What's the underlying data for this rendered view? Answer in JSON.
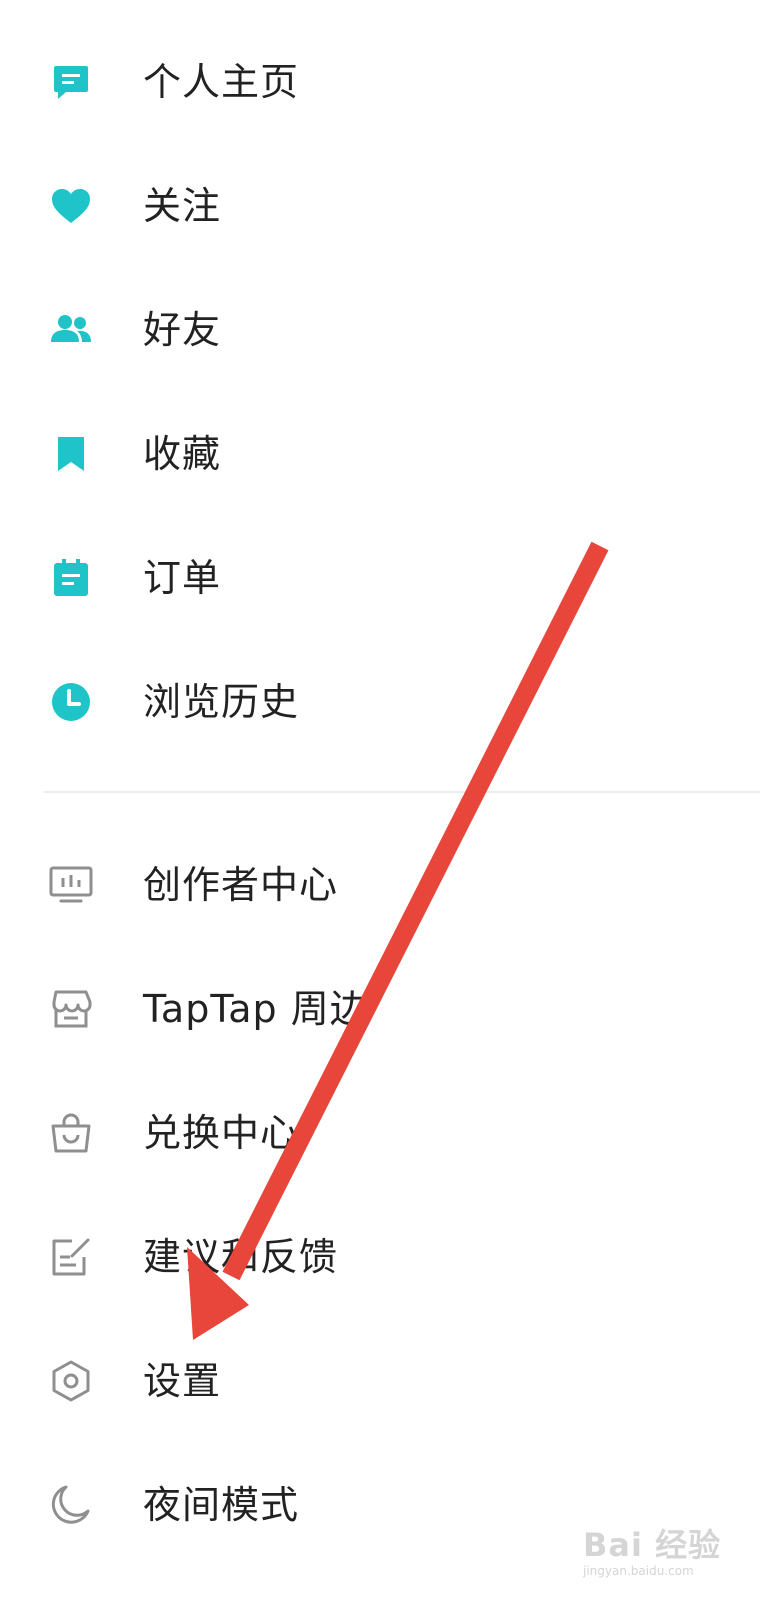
{
  "menu": {
    "primary": [
      {
        "label": "个人主页",
        "icon": "profile-page-icon"
      },
      {
        "label": "关注",
        "icon": "heart-icon"
      },
      {
        "label": "好友",
        "icon": "friends-icon"
      },
      {
        "label": "收藏",
        "icon": "bookmark-icon"
      },
      {
        "label": "订单",
        "icon": "order-icon"
      },
      {
        "label": "浏览历史",
        "icon": "clock-icon"
      }
    ],
    "secondary": [
      {
        "label": "创作者中心",
        "icon": "creator-monitor-icon"
      },
      {
        "label": "TapTap 周边",
        "icon": "shop-icon"
      },
      {
        "label": "兑换中心",
        "icon": "shopping-bag-icon"
      },
      {
        "label": "建议和反馈",
        "icon": "feedback-edit-icon"
      },
      {
        "label": "设置",
        "icon": "settings-hexagon-icon"
      },
      {
        "label": "夜间模式",
        "icon": "moon-icon"
      }
    ]
  },
  "colors": {
    "accent": "#1fc4c9",
    "secondary_icon": "#8f8f8f",
    "annotation_arrow": "#e8463a"
  },
  "watermark": {
    "text": "Bai 经验",
    "subtext": "jingyan.baidu.com"
  }
}
